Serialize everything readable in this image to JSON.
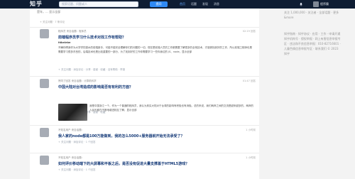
{
  "topbar": {
    "logo": "知乎",
    "search_placeholder": "搜索话题、问题或人",
    "ask_label": "提问",
    "nav": [
      "首页",
      "话题",
      "发现",
      "消息"
    ],
    "user": "程序猿"
  },
  "feed": {
    "fragment_text": "是年，... 显示全部",
    "fragment_meta": "+ 关注问题 · 7 条评论",
    "items": [
      {
        "meta": "程序员 来自话题：程序员",
        "time": "02:19 回答",
        "title": "前端程序员学习什么技术对找工作有帮助？",
        "author": "fdbelebe",
        "body": "不瞒你啊我作为大学学的挺水的前端新手，可能不能完全理解你们的问题的一切。现在是前端人员的工作都需要了解很多的全栈技术，才能够找到好的工作，所以前端工程师也是需要学习很多东西的，后端技术也是比较重要的一部分，为了找到好的工作你需要学习一些你身边的 JS、node，显示全部",
        "actions": "+ 关注问题 · 添加评论 · 分享 · 感谢 · 收藏 · 没有帮助 · 举报"
      },
      {
        "meta": "赞同了回答 来自话题：计算机科学",
        "time": "01:47 回答",
        "title": "中国大陆对台湾造成的影响是否有有利的方面？",
        "body": "我是中国浙江一个，作为一个普通的程序员，我认为其实大陆对于台湾的影响有积极也有消极。总的来说，我们两岸之间的交流是越来越多的，两岸的人民也都在不断地增进相互了解，显示全部",
        "actions": "+ 关注问题 · 添加评论 · 分享 · 感谢 · 收藏"
      },
      {
        "meta": "不知名用户 来自话题：",
        "time": "1 小时前",
        "title": "我人家的node都是100万能做到，我的怎么5000+服务器就开始无法承受了？",
        "actions": "+ 关注问题 · 添加评论 · 1 个回答"
      },
      {
        "meta": "不知名用户 来自话题：",
        "time": "1 小时前",
        "title": "如何评价移动端下的大屏幕和平板之后，是否没有促进大量支撑基于HTML5游戏？",
        "actions": "+ 关注问题 · 添加评论 · 1 个回答"
      }
    ]
  },
  "sidebar": {
    "top_text": "关注 1,000,000 · 关注者 · 全部话题 · 更多 &more",
    "links_text": "知乎指南 · 知乎协议 · 应用 · 工作 · 申请开通知乎机构号 · 侵权举报 · 网上有害信息举报专区 · 违法和不良信息举报：010-82716601 · 儿童色情信息举报专区 · 联系我们 © 2023 知乎"
  }
}
